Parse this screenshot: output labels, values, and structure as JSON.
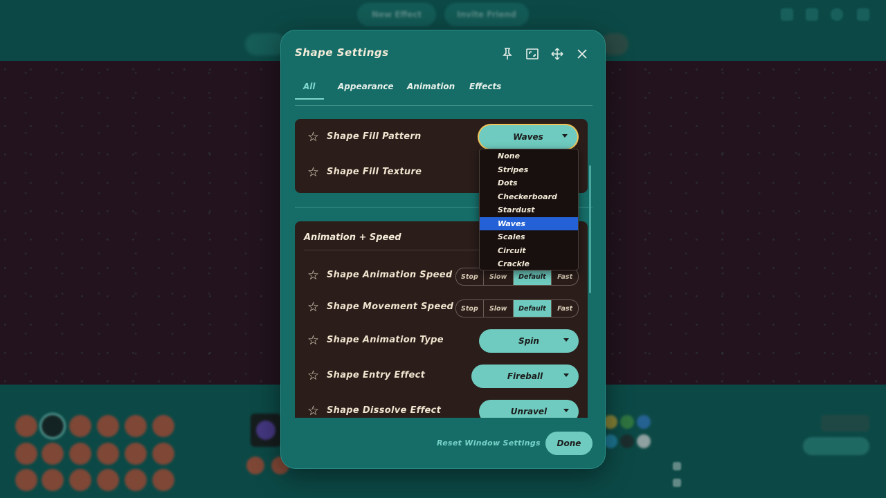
{
  "background": {
    "top_buttons": [
      "New Effect",
      "Invite Friend"
    ]
  },
  "dialog": {
    "title": "Shape Settings",
    "header_icons": [
      "pin-icon",
      "window-fit-icon",
      "move-icon",
      "close-icon"
    ],
    "tabs": [
      {
        "label": "All",
        "active": true
      },
      {
        "label": "Appearance",
        "active": false
      },
      {
        "label": "Animation",
        "active": false
      },
      {
        "label": "Effects",
        "active": false
      }
    ],
    "fill": {
      "pattern": {
        "label": "Shape Fill Pattern",
        "value": "Waves"
      },
      "texture": {
        "label": "Shape Fill Texture"
      }
    },
    "dropdown": {
      "options": [
        "None",
        "Stripes",
        "Dots",
        "Checkerboard",
        "Stardust",
        "Waves",
        "Scales",
        "Circuit",
        "Crackle"
      ],
      "selected": "Waves"
    },
    "animation_section": {
      "title": "Animation + Speed",
      "animation_speed": {
        "label": "Shape Animation Speed",
        "options": [
          "Stop",
          "Slow",
          "Default",
          "Fast"
        ],
        "selected": "Default"
      },
      "movement_speed": {
        "label": "Shape Movement Speed",
        "options": [
          "Stop",
          "Slow",
          "Default",
          "Fast"
        ],
        "selected": "Default"
      },
      "animation_type": {
        "label": "Shape Animation Type",
        "value": "Spin"
      },
      "entry_effect": {
        "label": "Shape Entry Effect",
        "value": "Fireball"
      },
      "dissolve_effect": {
        "label": "Shape Dissolve Effect",
        "value": "Unravel"
      }
    },
    "footer": {
      "reset_label": "Reset Window Settings",
      "done_label": "Done"
    }
  },
  "colors": {
    "dialog_bg": "#166d68",
    "panel_bg": "#2a1d1a",
    "accent": "#6fcbbf",
    "focus_ring": "#f1c45a",
    "selected_option": "#2461d6"
  }
}
